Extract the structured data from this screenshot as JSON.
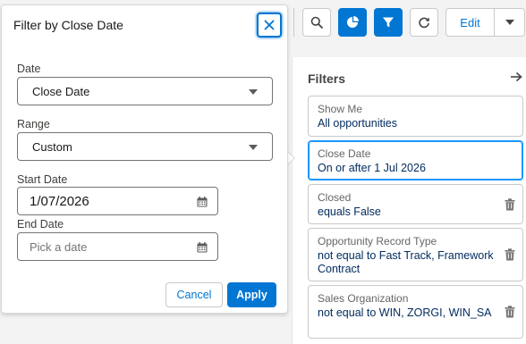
{
  "toolbar": {
    "edit_label": "Edit"
  },
  "filters": {
    "title": "Filters",
    "items": [
      {
        "label": "Show Me",
        "value": "All opportunities",
        "active": false,
        "removable": false
      },
      {
        "label": "Close Date",
        "value": "On or after 1 Jul 2026",
        "active": true,
        "removable": false
      },
      {
        "label": "Closed",
        "value": "equals False",
        "active": false,
        "removable": true
      },
      {
        "label": "Opportunity Record Type",
        "value": "not equal to Fast Track, Framework Contract",
        "active": false,
        "removable": true
      },
      {
        "label": "Sales Organization",
        "value": "not equal to WIN, ZORGI, WIN_SA",
        "active": false,
        "removable": true
      }
    ]
  },
  "popover": {
    "title": "Filter by Close Date",
    "date_label": "Date",
    "date_value": "Close Date",
    "range_label": "Range",
    "range_value": "Custom",
    "start_label": "Start Date",
    "start_value": "1/07/2026",
    "end_label": "End Date",
    "end_placeholder": "Pick a date",
    "cancel_label": "Cancel",
    "apply_label": "Apply"
  },
  "colors": {
    "brand": "#0176d3",
    "active_border": "#1b96ff",
    "value_text": "#032d60"
  }
}
